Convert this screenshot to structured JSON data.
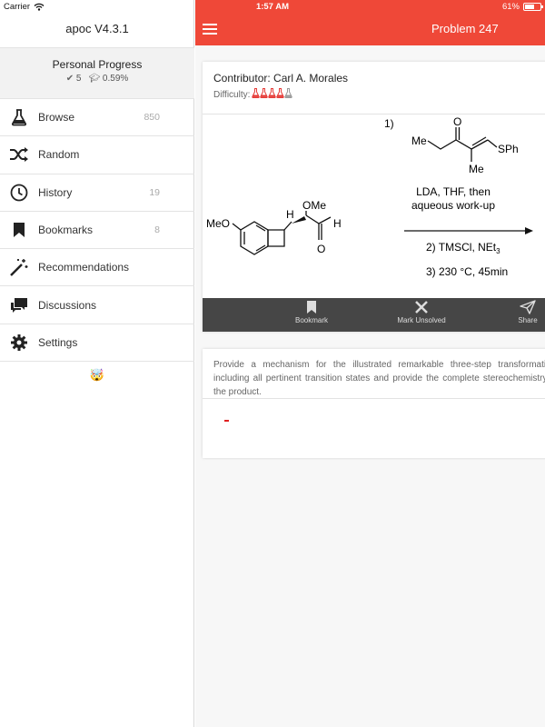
{
  "status": {
    "carrier": "Carrier",
    "time": "1:57 AM",
    "battery": "61%",
    "battery_level": 0.61
  },
  "sidebar": {
    "app_title": "apoc V4.3.1",
    "progress": {
      "title": "Personal Progress",
      "solved": "5",
      "percent": "0.59%"
    },
    "items": [
      {
        "label": "Browse",
        "count": "850",
        "icon": "flask-icon"
      },
      {
        "label": "Random",
        "count": "",
        "icon": "shuffle-icon"
      },
      {
        "label": "History",
        "count": "19",
        "icon": "clock-icon"
      },
      {
        "label": "Bookmarks",
        "count": "8",
        "icon": "bookmark-icon"
      },
      {
        "label": "Recommendations",
        "count": "",
        "icon": "magic-wand-icon"
      },
      {
        "label": "Discussions",
        "count": "",
        "icon": "chat-bubbles-icon"
      },
      {
        "label": "Settings",
        "count": "",
        "icon": "gear-icon"
      }
    ],
    "emoji": "🤯"
  },
  "nav": {
    "title": "Problem 247",
    "accent": "#ef4838"
  },
  "problem": {
    "contributor": "Contributor: Carl A. Morales",
    "difficulty_label": "Difficulty:",
    "difficulty_level": 4,
    "difficulty_max": 5,
    "scheme": {
      "step1": "1)",
      "reagent_me_top": "Me",
      "reagent_o": "O",
      "reagent_sph": "SPh",
      "reagent_me_bottom": "Me",
      "cond1_line1": "LDA, THF, then",
      "cond1_line2": "aqueous work-up",
      "cond2": "2) TMSCl, NEt",
      "cond2_sub": "3",
      "cond3": "3) 230 °C, 45min",
      "substrate_meo": "MeO",
      "substrate_h1": "H",
      "substrate_ome": "OMe",
      "substrate_h2": "H",
      "substrate_o": "O"
    },
    "toolbar": {
      "bookmark": "Bookmark",
      "mark_unsolved": "Mark Unsolved",
      "share": "Share"
    },
    "description": "Provide a mechanism for the illustrated remarkable three-step transformation, including all pertinent transition states and provide the complete stereochemistry of the product."
  }
}
